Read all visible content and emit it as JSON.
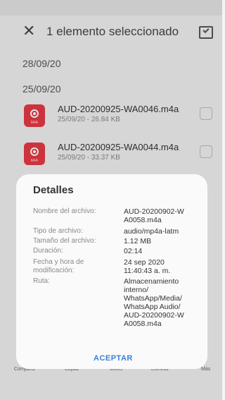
{
  "header": {
    "title": "1 elemento seleccionado"
  },
  "dates": [
    "28/09/20",
    "25/09/20"
  ],
  "files": [
    {
      "name": "AUD-20200925-WA0046.m4a",
      "meta": "25/09/20 - 26.84 KB"
    },
    {
      "name": "AUD-20200925-WA0044.m4a",
      "meta": "25/09/20 - 33.37 KB"
    }
  ],
  "bottom_bar": [
    "Compartir",
    "Copiar",
    "Mover",
    "Eliminar",
    "Más"
  ],
  "details": {
    "title": "Detalles",
    "rows": [
      {
        "label_lines": [
          "Nombre del archivo:"
        ],
        "value_lines": [
          "AUD-20200902-W",
          "A0058.m4a"
        ]
      },
      {
        "label_lines": [
          "Tipo de archivo:"
        ],
        "value_lines": [
          "audio/mp4a-latm"
        ]
      },
      {
        "label_lines": [
          "Tamaño del archivo:"
        ],
        "value_lines": [
          "1.12 MB"
        ]
      },
      {
        "label_lines": [
          "Duración:"
        ],
        "value_lines": [
          "02:14"
        ]
      },
      {
        "label_lines": [
          "Fecha y hora de",
          "modificación:"
        ],
        "value_lines": [
          "24 sep 2020",
          "11:40:43 a. m."
        ]
      },
      {
        "label_lines": [
          "Ruta:"
        ],
        "value_lines": [
          "Almacenamiento",
          "interno/",
          "WhatsApp/Media/",
          "WhatsApp Audio/",
          "AUD-20200902-W",
          "A0058.m4a"
        ]
      }
    ],
    "accept_label": "ACEPTAR"
  },
  "colors": {
    "audio_icon": "#e53945",
    "accent": "#3a7fd8"
  },
  "icons": {
    "close": "close-icon",
    "select_all": "select-all-icon",
    "file": "audio-file-icon"
  }
}
